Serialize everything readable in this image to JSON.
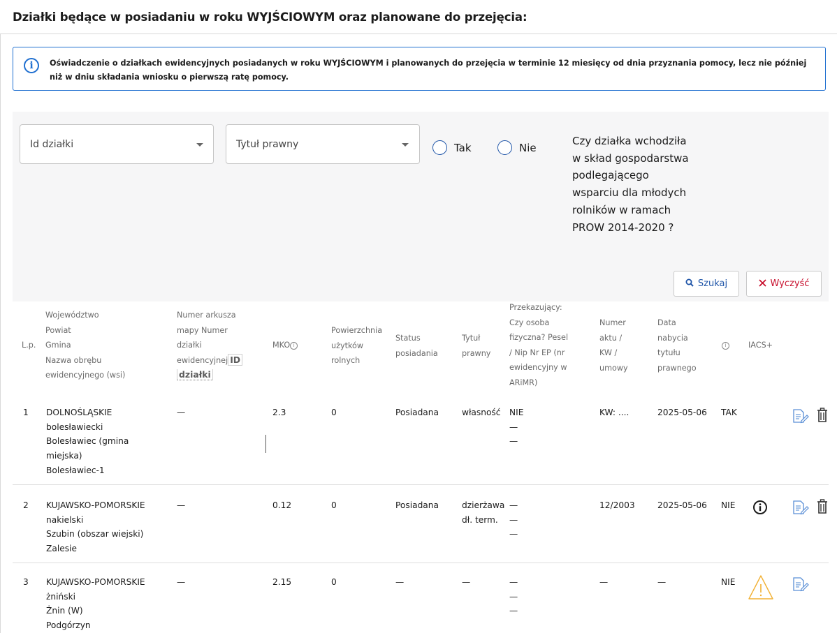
{
  "page": {
    "title": "Działki będące w posiadaniu w roku WYJŚCIOWYM oraz planowane do przejęcia:",
    "info_text": "Oświadczenie o działkach ewidencyjnych posiadanych w roku WYJŚCIOWYM i planowanych do przejęcia w terminie 12 miesięcy od dnia przyznania pomocy, lecz nie później niż w dniu składania wniosku o pierwszą ratę pomocy."
  },
  "filters": {
    "id_placeholder": "Id działki",
    "tytul_placeholder": "Tytuł prawny",
    "radio_tak": "Tak",
    "radio_nie": "Nie",
    "question": "Czy działka wchodziła w skład gospodarstwa podlegającego wsparciu dla młodych rolników w ramach PROW 2014-2020 ?",
    "search_label": "Szukaj",
    "clear_label": "Wyczyść"
  },
  "table": {
    "headers": {
      "lp": "L.p.",
      "location": [
        "Województwo",
        "Powiat",
        "Gmina",
        "Nazwa obrębu",
        "ewidencyjnego (wsi)"
      ],
      "arkusz": [
        "Numer arkusza",
        "mapy Numer",
        "działki",
        "ewidencyjnej"
      ],
      "arkusz_id": "ID",
      "arkusz_id2": "działki",
      "mko": "MKO",
      "powierzchnia": [
        "Powierzchnia",
        "użytków",
        "rolnych"
      ],
      "status": [
        "Status",
        "posiadania"
      ],
      "tytul": [
        "Tytuł",
        "prawny"
      ],
      "przekazujacy": [
        "Przekazujący:",
        "Czy osoba",
        "fizyczna? Pesel",
        "/ Nip Nr EP (nr",
        "ewidencyjny w",
        "ARiMR)"
      ],
      "numer": [
        "Numer",
        "aktu /",
        "KW /",
        "umowy"
      ],
      "data": [
        "Data",
        "nabycia",
        "tytułu",
        "prawnego"
      ],
      "iacs": "IACS+"
    },
    "rows": [
      {
        "lp": "1",
        "location": [
          "DOLNOŚLĄSKIE",
          "bolesławiecki",
          "Bolesławiec (gmina",
          "miejska)",
          "Bolesławiec-1"
        ],
        "arkusz": "—",
        "mko": "2.3",
        "powierzchnia": "0",
        "status": "Posiadana",
        "tytul": [
          "własność"
        ],
        "przekazujacy": [
          "NIE",
          "—",
          "—"
        ],
        "numer": "KW: ....",
        "data": "2025-05-06",
        "flag": "TAK",
        "iacs_icon": "",
        "actions": [
          "edit-icon",
          "trash-icon"
        ]
      },
      {
        "lp": "2",
        "location": [
          "KUJAWSKO-POMORSKIE",
          "nakielski",
          "Szubin (obszar wiejski)",
          "Zalesie"
        ],
        "arkusz": "—",
        "mko": "0.12",
        "powierzchnia": "0",
        "status": "Posiadana",
        "tytul": [
          "dzierżawa",
          "dł. term."
        ],
        "przekazujacy": [
          "—",
          "—",
          "—"
        ],
        "numer": "12/2003",
        "data": "2025-05-06",
        "flag": "NIE",
        "iacs_icon": "info-circle-icon",
        "actions": [
          "edit-icon",
          "trash-icon"
        ]
      },
      {
        "lp": "3",
        "location": [
          "KUJAWSKO-POMORSKIE",
          "żniński",
          "Żnin (W)",
          "Podgórzyn"
        ],
        "arkusz": "—",
        "mko": "2.15",
        "powierzchnia": "0",
        "status": "—",
        "tytul": [
          "—"
        ],
        "przekazujacy": [
          "—",
          "—",
          "—"
        ],
        "numer": "—",
        "data": "—",
        "flag": "NIE",
        "iacs_icon": "warning-triangle-icon",
        "actions": [
          "edit-icon"
        ]
      }
    ]
  },
  "colors": {
    "accent": "#1f6fd0",
    "radio": "#1f55a8",
    "danger": "#c8102e",
    "warning": "#f2b134",
    "panel_bg": "#f6f6f7"
  }
}
